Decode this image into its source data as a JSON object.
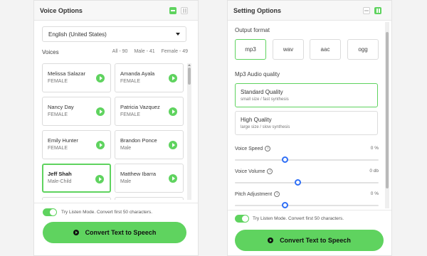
{
  "voice_options": {
    "title": "Voice Options",
    "language": "English (United States)",
    "voices_label": "Voices",
    "filters": [
      "All - 90",
      "Male - 41",
      "Female - 49"
    ],
    "voices": [
      {
        "name": "Melissa Salazar",
        "type": "FEMALE"
      },
      {
        "name": "Amanda Ayala",
        "type": "FEMALE"
      },
      {
        "name": "Nancy Day",
        "type": "FEMALE"
      },
      {
        "name": "Patricia Vazquez",
        "type": "FEMALE"
      },
      {
        "name": "Emily Hunter",
        "type": "FEMALE"
      },
      {
        "name": "Brandon Ponce",
        "type": "Male"
      },
      {
        "name": "Jeff Shah",
        "type": "Male-Child",
        "selected": true
      },
      {
        "name": "Matthew Ibarra",
        "type": "Male"
      }
    ],
    "listen_mode_text": "Try Listen Mode. Convert first 50 characters.",
    "listen_mode_on": true,
    "convert_label": "Convert Text to Speech"
  },
  "setting_options": {
    "title": "Setting Options",
    "output_format_label": "Output format",
    "formats": [
      "mp3",
      "wav",
      "aac",
      "ogg"
    ],
    "selected_format": "mp3",
    "quality_label": "Mp3 Audio quality",
    "qualities": [
      {
        "title": "Standard Quality",
        "subtitle": "small size / fast synthesis",
        "selected": true
      },
      {
        "title": "High Quality",
        "subtitle": "large size / slow synthesis",
        "selected": false
      }
    ],
    "sliders": [
      {
        "label": "Voice Speed",
        "value": "0 %",
        "position_fraction": 0.35
      },
      {
        "label": "Voice Volume",
        "value": "0 db",
        "position_fraction": 0.44
      },
      {
        "label": "Pitch Adjustment",
        "value": "0 %",
        "position_fraction": 0.35
      }
    ],
    "info_icon_glyph": "i",
    "listen_mode_text": "Try Listen Mode. Convert first 50 characters.",
    "listen_mode_on": true,
    "convert_label": "Convert Text to Speech"
  },
  "colors": {
    "accent": "#5fd35f",
    "slider_thumb": "#2f6ff6"
  },
  "icons": [
    "minimize-icon",
    "pause-icon",
    "play-icon",
    "info-icon",
    "chevron-down-icon",
    "toggle-switch"
  ]
}
